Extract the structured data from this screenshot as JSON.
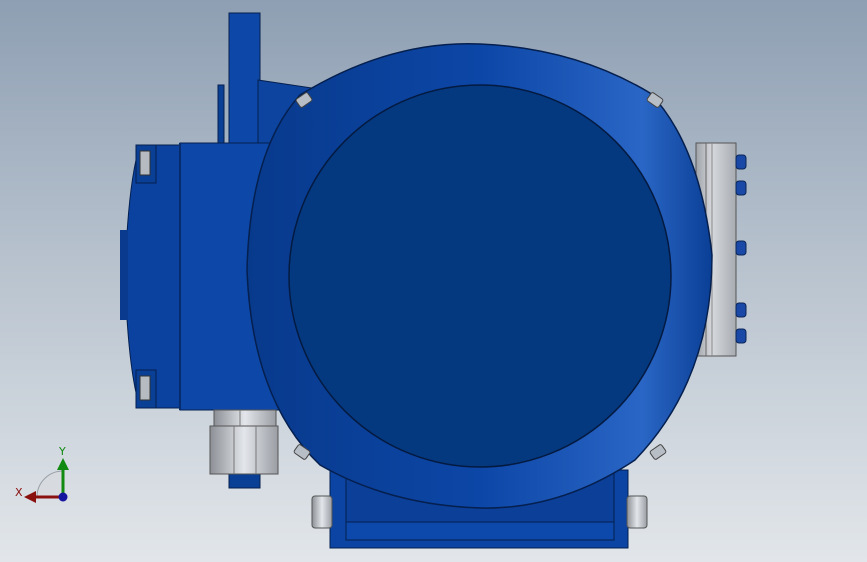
{
  "viewport": {
    "background_top": "#8e9fb3",
    "background_bottom": "#e2e6ea"
  },
  "model": {
    "body_color": "#0a3f96",
    "highlight_color": "#2c68c7",
    "dark_color": "#062c6e",
    "metal_color": "#c9cdd2"
  },
  "triad": {
    "x_label": "X",
    "y_label": "Y",
    "x_color": "#8a1010",
    "y_color": "#118a11",
    "z_color": "#1515a0"
  }
}
